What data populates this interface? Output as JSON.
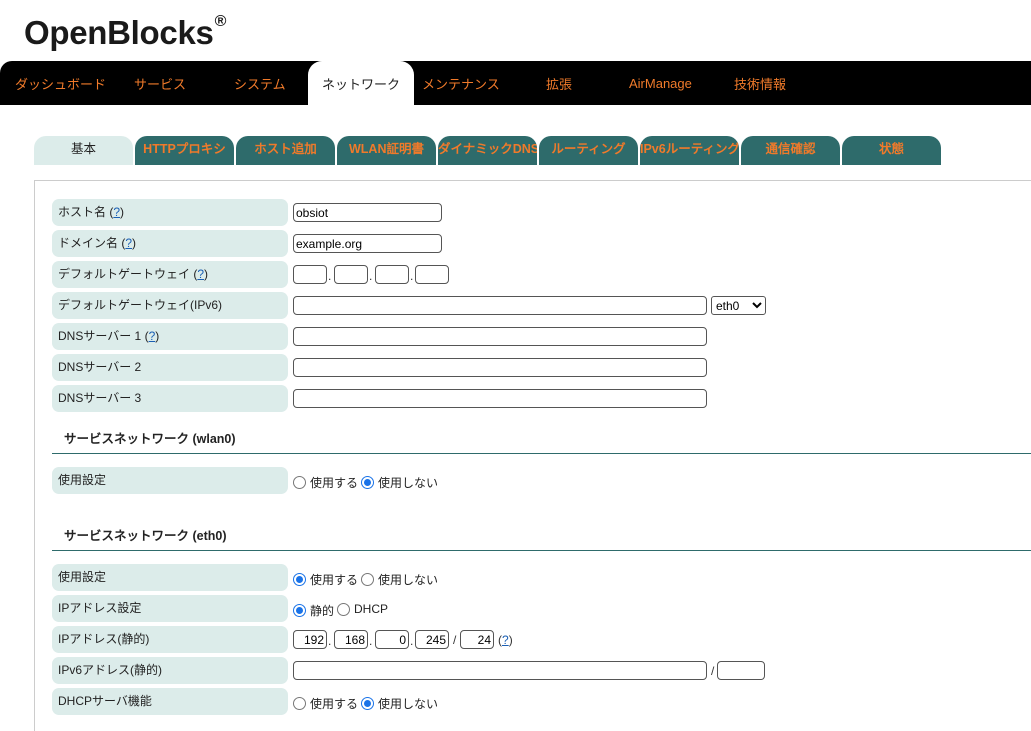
{
  "brand": {
    "name": "OpenBlocks",
    "mark": "®"
  },
  "topnav": [
    "ダッシュボード",
    "サービス",
    "システム",
    "ネットワーク",
    "メンテナンス",
    "拡張",
    "AirManage",
    "技術情報"
  ],
  "subtabs": [
    "基本",
    "HTTPプロキシ",
    "ホスト追加",
    "WLAN証明書",
    "ダイナミックDNS",
    "ルーティング",
    "IPv6ルーティング",
    "通信確認",
    "状態"
  ],
  "help": "?",
  "form": {
    "hostname": {
      "label": "ホスト名",
      "value": "obsiot"
    },
    "domain": {
      "label": "ドメイン名",
      "value": "example.org"
    },
    "gateway": {
      "label": "デフォルトゲートウェイ",
      "octets": [
        "",
        "",
        "",
        ""
      ]
    },
    "gateway6": {
      "label": "デフォルトゲートウェイ(IPv6)",
      "value": "",
      "iface": "eth0"
    },
    "dns1": {
      "label": "DNSサーバー 1",
      "value": ""
    },
    "dns2": {
      "label": "DNSサーバー 2",
      "value": ""
    },
    "dns3": {
      "label": "DNSサーバー 3",
      "value": ""
    }
  },
  "wlan0": {
    "title": "サービスネットワーク (wlan0)",
    "usage": {
      "label": "使用設定",
      "on": "使用する",
      "off": "使用しない",
      "selected": "off"
    }
  },
  "eth0": {
    "title": "サービスネットワーク (eth0)",
    "usage": {
      "label": "使用設定",
      "on": "使用する",
      "off": "使用しない",
      "selected": "on"
    },
    "ipmode": {
      "label": "IPアドレス設定",
      "static": "静的",
      "dhcp": "DHCP",
      "selected": "static"
    },
    "ip": {
      "label": "IPアドレス(静的)",
      "octets": [
        "192",
        "168",
        "0",
        "245"
      ],
      "prefix": "24"
    },
    "ip6": {
      "label": "IPv6アドレス(静的)",
      "value": "",
      "prefix": ""
    },
    "dhcpd": {
      "label": "DHCPサーバ機能",
      "on": "使用する",
      "off": "使用しない",
      "selected": "off"
    }
  },
  "colors": {
    "accent": "#f07a2a",
    "tab": "#2e6b6b",
    "label_bg": "#dcecea",
    "radio": "#1a73e8"
  }
}
